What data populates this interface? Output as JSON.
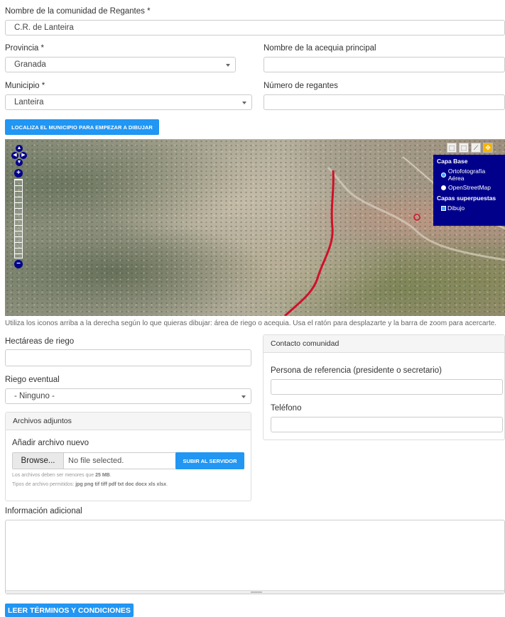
{
  "form": {
    "community_label": "Nombre de la comunidad de Regantes *",
    "community_value": "C.R. de Lanteira",
    "province_label": "Provincia *",
    "province_value": "Granada",
    "canal_label": "Nombre de la acequia principal",
    "canal_value": "",
    "municipality_label": "Municipio *",
    "municipality_value": "Lanteira",
    "irrigators_label": "Número de regantes",
    "irrigators_value": "",
    "locate_button": "LOCALIZA EL MUNICIPIO PARA EMPEZAR A DIBUJAR"
  },
  "map": {
    "zoom_in": "+",
    "zoom_out": "−",
    "pan_up": "▲",
    "pan_down": "▼",
    "pan_left": "◀",
    "pan_right": "▶",
    "tools": [
      "⬚",
      "⬚",
      "⟋",
      "✥"
    ],
    "layers": {
      "base_heading": "Capa Base",
      "base_options": [
        "Ortofotografía Aérea",
        "OpenStreetMap"
      ],
      "base_selected": "Ortofotografía Aérea",
      "overlay_heading": "Capas superpuestas",
      "overlay_options": [
        "Dibujo"
      ]
    },
    "help_text": "Utiliza los iconos arriba a la derecha según lo que quieras dibujar: área de riego o acequia. Usa el ratón para desplazarte y la barra de zoom para acercarte."
  },
  "irrigation": {
    "hectares_label": "Hectáreas de riego",
    "hectares_value": "",
    "eventual_label": "Riego eventual",
    "eventual_value": "- Ninguno -"
  },
  "attachments": {
    "panel_title": "Archivos adjuntos",
    "add_label": "Añadir archivo nuevo",
    "browse_button": "Browse...",
    "file_status": "No file selected.",
    "upload_button": "SUBIR AL SERVIDOR",
    "size_note_prefix": "Los archivos deben ser menores que ",
    "size_note_value": "25 MB",
    "types_note_prefix": "Tipos de archivo permitidos: ",
    "types_note_value": "jpg png tif tiff pdf txt doc docx xls xlsx"
  },
  "contact": {
    "panel_title": "Contacto comunidad",
    "person_label": "Persona de referencia (presidente o secretario)",
    "person_value": "",
    "phone_label": "Teléfono",
    "phone_value": ""
  },
  "additional": {
    "label": "Información adicional",
    "value": ""
  },
  "terms_button": "LEER TÉRMINOS Y CONDICIONES",
  "colors": {
    "accent": "#2196f3",
    "map_panel": "#00008b",
    "route": "#d0102a"
  }
}
